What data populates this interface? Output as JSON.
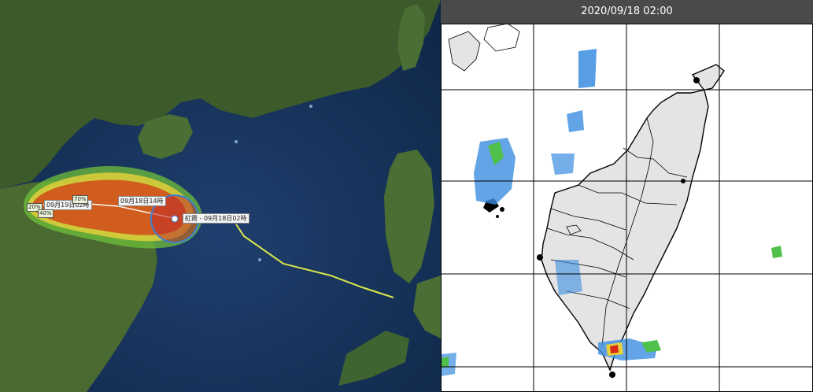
{
  "track_map": {
    "labels": {
      "current_position": "紅霞 - 09月18日02時",
      "forecast_12h": "09月18日14時",
      "forecast_24h": "09月19日02時"
    },
    "probability_labels": [
      "20%",
      "40%",
      "70%"
    ],
    "colors": {
      "track_line": "#d8e84a",
      "cone_outer": "#6fbf3a",
      "cone_mid": "#e8d23a",
      "cone_inner": "#d04a1a",
      "storm_circle": "#3b7fd6"
    }
  },
  "radar": {
    "timestamp": "2020/09/18 02:00",
    "colors": {
      "header_bg": "#4a4a4a",
      "land_fill": "#e4e4e4",
      "grid_line": "#000000"
    }
  }
}
